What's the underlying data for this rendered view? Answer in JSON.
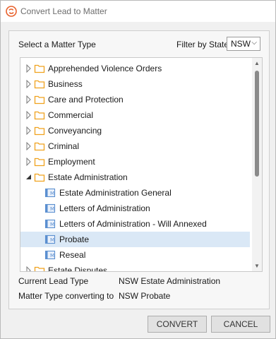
{
  "window": {
    "title": "Convert Lead to Matter"
  },
  "header": {
    "select_label": "Select a Matter Type",
    "filter_label": "Filter by State",
    "state_value": "NSW"
  },
  "tree": {
    "items": [
      {
        "label": "Apprehended Violence Orders",
        "type": "folder",
        "expanded": false
      },
      {
        "label": "Business",
        "type": "folder",
        "expanded": false
      },
      {
        "label": "Care and Protection",
        "type": "folder",
        "expanded": false
      },
      {
        "label": "Commercial",
        "type": "folder",
        "expanded": false
      },
      {
        "label": "Conveyancing",
        "type": "folder",
        "expanded": false
      },
      {
        "label": "Criminal",
        "type": "folder",
        "expanded": false
      },
      {
        "label": "Employment",
        "type": "folder",
        "expanded": false
      },
      {
        "label": "Estate Administration",
        "type": "folder",
        "expanded": true
      },
      {
        "label": "Estate Administration General",
        "type": "matter"
      },
      {
        "label": "Letters of Administration",
        "type": "matter"
      },
      {
        "label": "Letters of Administration - Will Annexed",
        "type": "matter"
      },
      {
        "label": "Probate",
        "type": "matter",
        "selected": true
      },
      {
        "label": "Reseal",
        "type": "matter"
      },
      {
        "label": "Estate Disputes",
        "type": "folder",
        "expanded": false
      }
    ]
  },
  "info": {
    "current_lead_label": "Current Lead Type",
    "current_lead_value": "NSW Estate Administration",
    "converting_label": "Matter Type converting to",
    "converting_value": "NSW Probate"
  },
  "buttons": {
    "convert": "CONVERT",
    "cancel": "CANCEL"
  },
  "colors": {
    "folder": "#f0a21e",
    "matter_icon": "#5b8fd0",
    "selection": "#dae8f6",
    "logo": "#e8612c"
  }
}
